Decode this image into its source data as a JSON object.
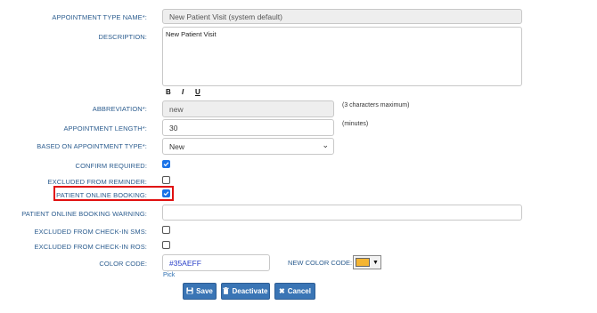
{
  "fields": {
    "appointment_type_name": {
      "label": "APPOINTMENT TYPE NAME*:",
      "value": "New Patient Visit (system default)"
    },
    "description": {
      "label": "DESCRIPTION:",
      "value": "New Patient Visit"
    },
    "formatting": {
      "bold": "B",
      "italic": "I",
      "underline": "U"
    },
    "abbreviation": {
      "label": "ABBREVIATION*:",
      "value": "new",
      "note": "(3 characters maximum)"
    },
    "appointment_length": {
      "label": "APPOINTMENT LENGTH*:",
      "value": "30",
      "note": "(minutes)"
    },
    "based_on": {
      "label": "BASED ON APPOINTMENT TYPE*:",
      "value": "New"
    },
    "confirm_required": {
      "label": "CONFIRM REQUIRED:",
      "checked": true
    },
    "excluded_from_reminder": {
      "label": "EXCLUDED FROM REMINDER:",
      "checked": false
    },
    "patient_online_booking": {
      "label": "PATIENT ONLINE BOOKING:",
      "checked": true
    },
    "patient_online_booking_warning": {
      "label": "PATIENT ONLINE BOOKING WARNING:",
      "value": ""
    },
    "excluded_checkin_sms": {
      "label": "EXCLUDED FROM CHECK-IN SMS:",
      "checked": false
    },
    "excluded_checkin_ros": {
      "label": "EXCLUDED FROM CHECK-IN ROS:",
      "checked": false
    },
    "color_code": {
      "label": "COLOR CODE:",
      "value": "#35AEFF",
      "pick": "Pick"
    },
    "new_color_code": {
      "label": "NEW COLOR CODE:",
      "swatch": "#f5b533"
    }
  },
  "buttons": {
    "save": "Save",
    "deactivate": "Deactivate",
    "cancel": "Cancel"
  },
  "colors": {
    "label": "#2c5d8f",
    "button": "#3a75b5",
    "checkbox": "#1a73e8",
    "highlight": "#e01010"
  }
}
